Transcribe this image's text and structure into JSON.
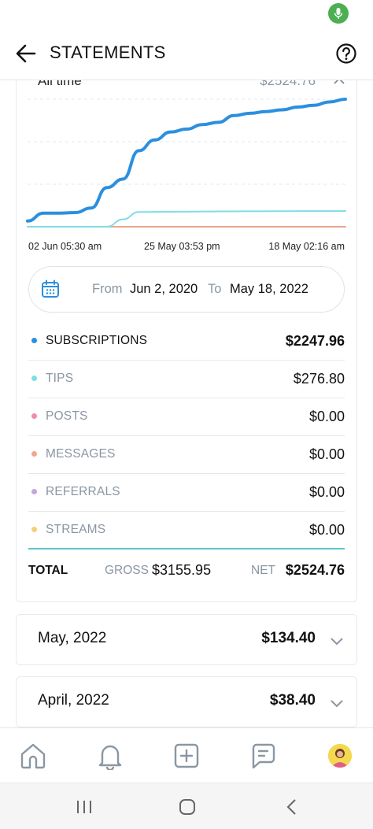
{
  "header": {
    "title": "STATEMENTS"
  },
  "summary": {
    "period_label": "All time",
    "period_total": "$2524.76"
  },
  "chart_data": {
    "type": "line",
    "x_labels": [
      "02 Jun 05:30 am",
      "25 May 03:53 pm",
      "18 May 02:16 am"
    ],
    "series": [
      {
        "color": "#2c8fde",
        "values": [
          100,
          240,
          240,
          250,
          330,
          690,
          840,
          1340,
          1530,
          1670,
          1720,
          1800,
          1840,
          1960,
          2000,
          2030,
          2060,
          2110,
          2140,
          2200,
          2247.96
        ]
      },
      {
        "color": "#7fdde7",
        "values": [
          0,
          0,
          0,
          0,
          0,
          0,
          130,
          260,
          262,
          264,
          266,
          268,
          270,
          271,
          272,
          273,
          274,
          275,
          276,
          276.5,
          276.8
        ]
      },
      {
        "color": "#e9a48f",
        "values": [
          0,
          0,
          0,
          0,
          0,
          0,
          0,
          0,
          0,
          0,
          0,
          0,
          0,
          0,
          0,
          0,
          0,
          0,
          0,
          0,
          0
        ]
      }
    ],
    "grid": true,
    "legend": "none"
  },
  "date_range": {
    "from_label": "From",
    "from_date": "Jun 2, 2020",
    "to_label": "To",
    "to_date": "May 18, 2022"
  },
  "categories": [
    {
      "label": "SUBSCRIPTIONS",
      "amount": "$2247.96",
      "color": "#2c8fde"
    },
    {
      "label": "TIPS",
      "amount": "$276.80",
      "color": "#7fdde7"
    },
    {
      "label": "POSTS",
      "amount": "$0.00",
      "color": "#f08bb0"
    },
    {
      "label": "MESSAGES",
      "amount": "$0.00",
      "color": "#f2a58e"
    },
    {
      "label": "REFERRALS",
      "amount": "$0.00",
      "color": "#c7a5dc"
    },
    {
      "label": "STREAMS",
      "amount": "$0.00",
      "color": "#f7cf7a"
    }
  ],
  "totals": {
    "label": "TOTAL",
    "gross_label": "GROSS",
    "gross_value": "$3155.95",
    "net_label": "NET",
    "net_value": "$2524.76"
  },
  "months": [
    {
      "name": "May, 2022",
      "total": "$134.40"
    },
    {
      "name": "April, 2022",
      "total": "$38.40"
    }
  ],
  "icons": {
    "back": "arrow-left-icon",
    "help": "help-circle-icon",
    "calendar": "calendar-icon",
    "home": "home-icon",
    "notifications": "bell-icon",
    "add": "plus-square-icon",
    "messages": "chat-icon"
  }
}
